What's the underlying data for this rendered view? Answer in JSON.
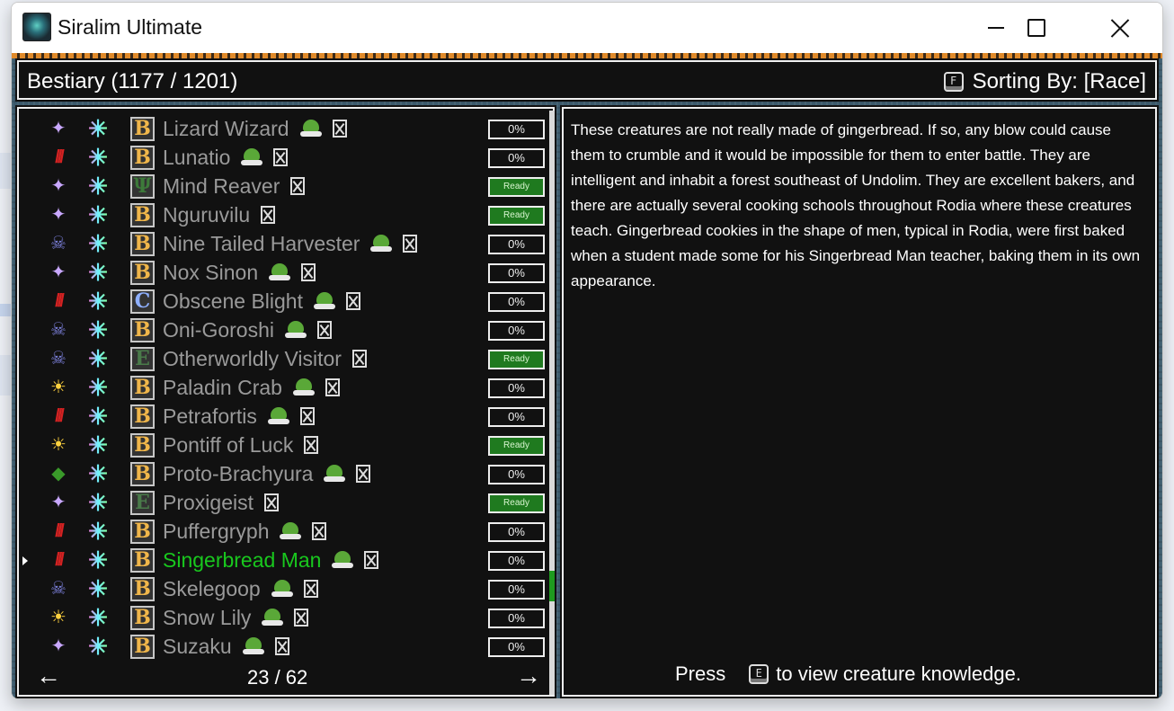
{
  "window": {
    "title": "Siralim Ultimate"
  },
  "header": {
    "title": "Bestiary (1177 / 1201)",
    "sort_key": "F",
    "sort_label": "Sorting By: [Race]"
  },
  "creatures": [
    {
      "name": "Lizard Wizard",
      "race_icon": "arcana-icon",
      "rarity": "B",
      "has_blob": true,
      "progress": "0%",
      "ready": false,
      "selected": false
    },
    {
      "name": "Lunatio",
      "race_icon": "chaos-icon",
      "rarity": "B",
      "has_blob": true,
      "progress": "0%",
      "ready": false,
      "selected": false
    },
    {
      "name": "Mind Reaver",
      "race_icon": "arcana-icon",
      "rarity": "L",
      "has_blob": false,
      "progress": "Ready",
      "ready": true,
      "selected": false
    },
    {
      "name": "Nguruvilu",
      "race_icon": "arcana-icon",
      "rarity": "B",
      "has_blob": false,
      "progress": "Ready",
      "ready": true,
      "selected": false
    },
    {
      "name": "Nine Tailed Harvester",
      "race_icon": "death-icon",
      "rarity": "B",
      "has_blob": true,
      "progress": "0%",
      "ready": false,
      "selected": false
    },
    {
      "name": "Nox Sinon",
      "race_icon": "arcana-icon",
      "rarity": "B",
      "has_blob": true,
      "progress": "0%",
      "ready": false,
      "selected": false
    },
    {
      "name": "Obscene Blight",
      "race_icon": "chaos-icon",
      "rarity": "C",
      "has_blob": true,
      "progress": "0%",
      "ready": false,
      "selected": false
    },
    {
      "name": "Oni-Goroshi",
      "race_icon": "death-icon",
      "rarity": "B",
      "has_blob": true,
      "progress": "0%",
      "ready": false,
      "selected": false
    },
    {
      "name": "Otherworldly Visitor",
      "race_icon": "death-icon",
      "rarity": "E",
      "has_blob": false,
      "progress": "Ready",
      "ready": true,
      "selected": false
    },
    {
      "name": "Paladin Crab",
      "race_icon": "life-icon",
      "rarity": "B",
      "has_blob": true,
      "progress": "0%",
      "ready": false,
      "selected": false
    },
    {
      "name": "Petrafortis",
      "race_icon": "chaos-icon",
      "rarity": "B",
      "has_blob": true,
      "progress": "0%",
      "ready": false,
      "selected": false
    },
    {
      "name": "Pontiff of Luck",
      "race_icon": "life-icon",
      "rarity": "B",
      "has_blob": false,
      "progress": "Ready",
      "ready": true,
      "selected": false
    },
    {
      "name": "Proto-Brachyura",
      "race_icon": "nature-icon",
      "rarity": "B",
      "has_blob": true,
      "progress": "0%",
      "ready": false,
      "selected": false
    },
    {
      "name": "Proxigeist",
      "race_icon": "arcana-icon",
      "rarity": "E",
      "has_blob": false,
      "progress": "Ready",
      "ready": true,
      "selected": false
    },
    {
      "name": "Puffergryph",
      "race_icon": "chaos-icon",
      "rarity": "B",
      "has_blob": true,
      "progress": "0%",
      "ready": false,
      "selected": false
    },
    {
      "name": "Singerbread Man",
      "race_icon": "chaos-icon",
      "rarity": "B",
      "has_blob": true,
      "progress": "0%",
      "ready": false,
      "selected": true
    },
    {
      "name": "Skelegoop",
      "race_icon": "death-icon",
      "rarity": "B",
      "has_blob": true,
      "progress": "0%",
      "ready": false,
      "selected": false
    },
    {
      "name": "Snow Lily",
      "race_icon": "life-icon",
      "rarity": "B",
      "has_blob": true,
      "progress": "0%",
      "ready": false,
      "selected": false
    },
    {
      "name": "Suzaku",
      "race_icon": "arcana-icon",
      "rarity": "B",
      "has_blob": true,
      "progress": "0%",
      "ready": false,
      "selected": false
    }
  ],
  "pager": {
    "prev": "←",
    "text": "23 / 62",
    "next": "→"
  },
  "description": {
    "text": "These creatures are not really made of gingerbread. If so, any blow could cause them to crumble and it would be impossible for them to enter battle. They are intelligent and inhabit a forest southeast of Undolim. They are excellent bakers, and there are actually several cooking schools throughout Rodia where these creatures teach. Gingerbread cookies in the shape of men, typical in Rodia, were first baked when a student made some for his Singerbread Man teacher, baking them in its own appearance.",
    "press_label": "Press",
    "press_key": "E",
    "press_suffix": "to view creature knowledge."
  }
}
